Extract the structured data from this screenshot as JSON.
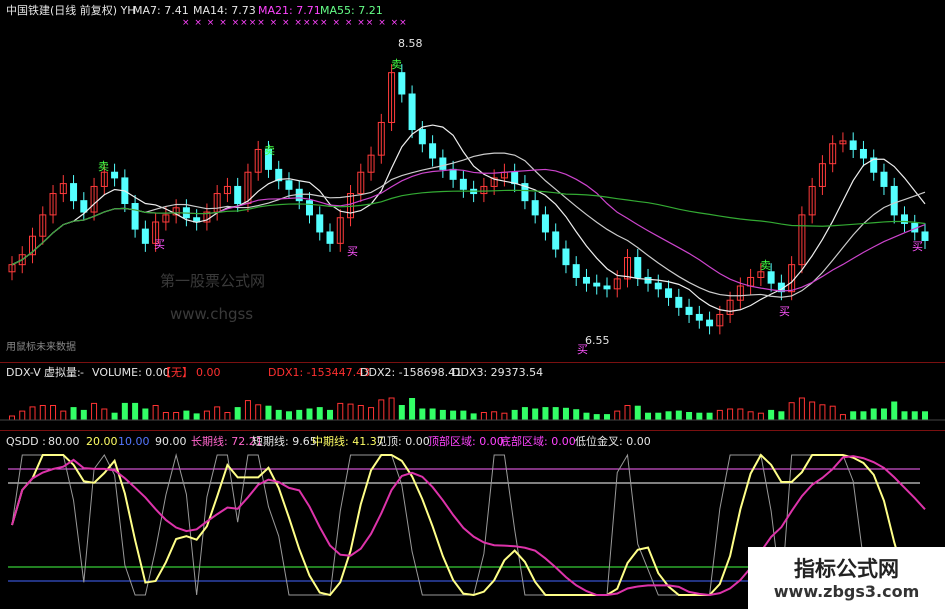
{
  "main": {
    "title": "中国铁建(日线 前复权) YH",
    "ma7": "MA7: 7.41",
    "ma14": "MA14: 7.73",
    "ma21": "MA21: 7.71",
    "ma55": "MA55: 7.21",
    "high_label": "8.58",
    "low_label": "6.55",
    "sell": "卖",
    "buy": "买",
    "watermark1": "第一股票公式网",
    "watermark2": "www.chgss",
    "bottom_note": "用鼠标未来数据",
    "cross_marks": "× ×  × ×  ××××  ×  ×  ××××  ×  ×  ××  ×  ××"
  },
  "ddx": {
    "name": "DDX-V",
    "label_a": "虚拟量:",
    "label_a_val": "-",
    "volume": "VOLUME: 0.00",
    "box": "【无】",
    "box_val": "0.00",
    "ddx1": "DDX1: -153447.43",
    "ddx2": "DDX2: -158698.41",
    "ddx3": "DDX3: 29373.54"
  },
  "qsdd": {
    "name": "QSDD :",
    "v80": "80.00",
    "v20": "20.00",
    "v10": "10.00",
    "v90": "90.00",
    "long": "长期线: 72.21",
    "short": "短期线: 9.65",
    "mid": "中期线: 41.37",
    "see_top": "见顶: 0.00",
    "top_zone": "顶部区域: 0.00",
    "bottom_zone": "底部区域: 0.00",
    "low_cross": "低位金叉: 0.00"
  },
  "brand": {
    "title": "指标公式网",
    "url": "www.zbgs3.com"
  },
  "chart_data": {
    "type": "candlestick",
    "closes": [
      7.05,
      7.12,
      7.25,
      7.4,
      7.55,
      7.62,
      7.5,
      7.42,
      7.6,
      7.7,
      7.66,
      7.48,
      7.3,
      7.2,
      7.35,
      7.4,
      7.45,
      7.38,
      7.35,
      7.42,
      7.55,
      7.6,
      7.48,
      7.7,
      7.86,
      7.72,
      7.64,
      7.58,
      7.5,
      7.4,
      7.28,
      7.2,
      7.38,
      7.55,
      7.7,
      7.82,
      8.05,
      8.4,
      8.25,
      8.0,
      7.9,
      7.8,
      7.72,
      7.65,
      7.58,
      7.55,
      7.6,
      7.66,
      7.7,
      7.62,
      7.5,
      7.4,
      7.28,
      7.16,
      7.05,
      6.96,
      6.92,
      6.9,
      6.88,
      6.95,
      7.1,
      6.96,
      6.92,
      6.88,
      6.82,
      6.75,
      6.7,
      6.66,
      6.62,
      6.7,
      6.8,
      6.9,
      6.96,
      7.0,
      6.92,
      6.86,
      7.05,
      7.4,
      7.6,
      7.76,
      7.9,
      7.92,
      7.86,
      7.8,
      7.7,
      7.6,
      7.4,
      7.34,
      7.28,
      7.22
    ],
    "high": 8.58,
    "low": 6.55
  }
}
